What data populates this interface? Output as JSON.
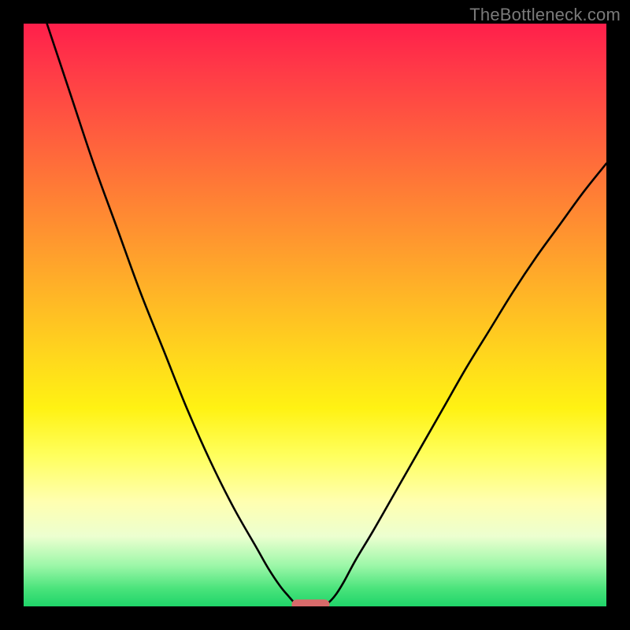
{
  "watermark": "TheBottleneck.com",
  "chart_data": {
    "type": "line",
    "title": "",
    "xlabel": "",
    "ylabel": "",
    "xlim": [
      0,
      100
    ],
    "ylim": [
      0,
      100
    ],
    "grid": false,
    "legend": false,
    "series": [
      {
        "name": "left-branch",
        "x": [
          4,
          8,
          12,
          16,
          20,
          24,
          28,
          32,
          36,
          40,
          42,
          44,
          45.5,
          46.5,
          47.3
        ],
        "y": [
          100,
          88,
          76,
          65,
          54,
          44,
          34,
          25,
          17,
          10,
          6.5,
          3.5,
          1.7,
          0.6,
          0.1
        ]
      },
      {
        "name": "right-branch",
        "x": [
          51.4,
          52.5,
          53.7,
          55,
          57,
          60,
          64,
          68,
          72,
          76,
          80,
          84,
          88,
          92,
          96,
          100
        ],
        "y": [
          0.1,
          0.8,
          2.2,
          4.3,
          8,
          13,
          20,
          27,
          34,
          41,
          47.5,
          54,
          60,
          65.5,
          71,
          76
        ]
      }
    ],
    "marker": {
      "name": "bottleneck-point",
      "x_range": [
        46,
        52.5
      ],
      "y": 0.3,
      "color": "#d86a6a"
    },
    "gradient_axis": "vertical",
    "gradient_stops": [
      {
        "pos": 0.0,
        "color": "#ff1f4b"
      },
      {
        "pos": 0.5,
        "color": "#ffba25"
      },
      {
        "pos": 0.7,
        "color": "#ffff5c"
      },
      {
        "pos": 0.9,
        "color": "#9cf7a8"
      },
      {
        "pos": 1.0,
        "color": "#1fd469"
      }
    ]
  },
  "plot_geometry": {
    "inner_left": 30,
    "inner_top": 30,
    "inner_width": 740,
    "inner_height": 740
  }
}
